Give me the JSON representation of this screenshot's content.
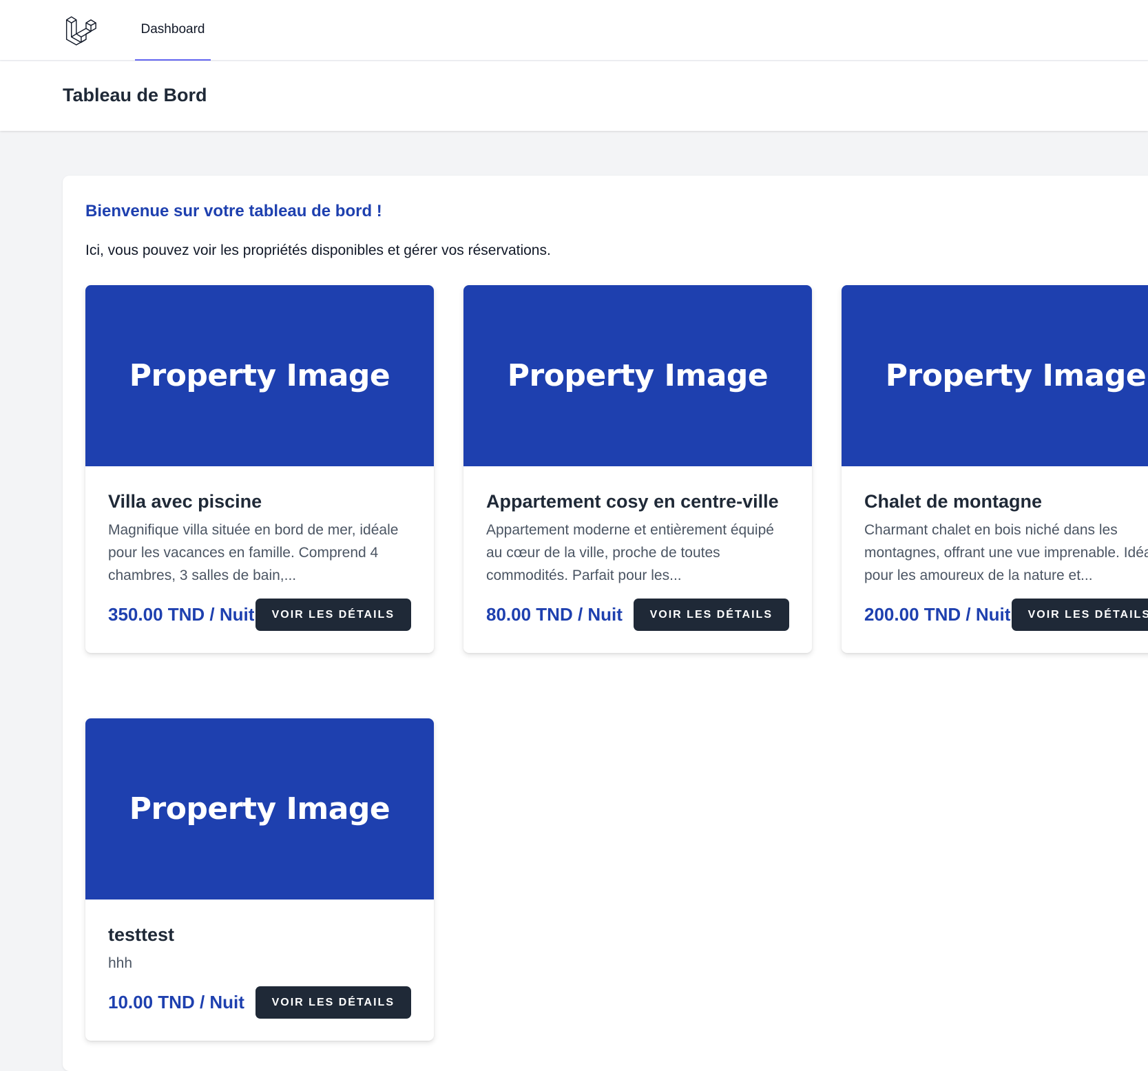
{
  "nav": {
    "logo_icon": "laravel-logo-icon",
    "dashboard_label": "Dashboard"
  },
  "header": {
    "title": "Tableau de Bord"
  },
  "main": {
    "welcome": "Bienvenue sur votre tableau de bord !",
    "intro": "Ici, vous pouvez voir les propriétés disponibles et gérer vos réservations.",
    "properties": [
      {
        "image_label": "Property Image",
        "title": "Villa avec piscine",
        "description": "Magnifique villa située en bord de mer, idéale pour les vacances en famille. Comprend 4 chambres, 3 salles de bain,...",
        "price": "350.00 TND / Nuit",
        "button": "VOIR LES DÉTAILS"
      },
      {
        "image_label": "Property Image",
        "title": "Appartement cosy en centre-ville",
        "description": "Appartement moderne et entièrement équipé au cœur de la ville, proche de toutes commodités. Parfait pour les...",
        "price": "80.00 TND / Nuit",
        "button": "VOIR LES DÉTAILS"
      },
      {
        "image_label": "Property Image",
        "title": "Chalet de montagne",
        "description": "Charmant chalet en bois niché dans les montagnes, offrant une vue imprenable. Idéal pour les amoureux de la nature et...",
        "price": "200.00 TND / Nuit",
        "button": "VOIR LES DÉTAILS"
      },
      {
        "image_label": "Property Image",
        "title": "testtest",
        "description": "hhh",
        "price": "10.00 TND / Nuit",
        "button": "VOIR LES DÉTAILS"
      }
    ]
  },
  "colors": {
    "accent": "#1e40af",
    "button_bg": "#1f2937",
    "nav_underline": "#6366f1"
  }
}
